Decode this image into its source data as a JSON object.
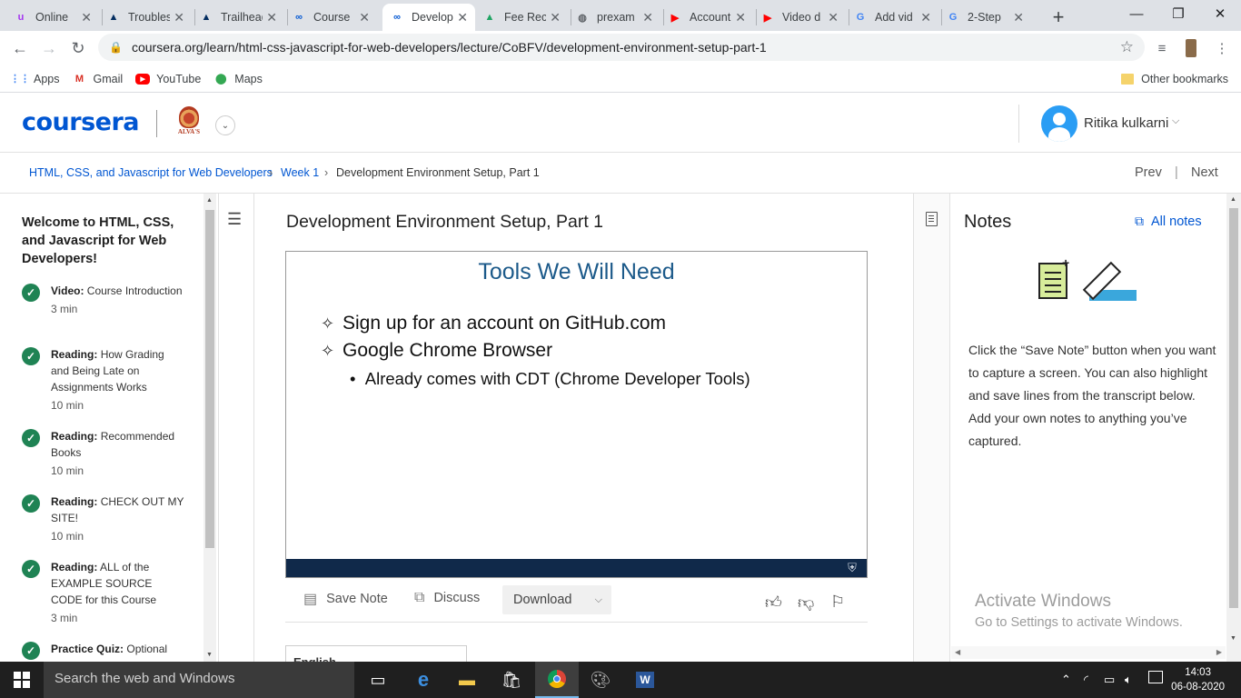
{
  "browser": {
    "tabs": [
      {
        "title": "Online",
        "icon": "udemy-icon",
        "color": "#a435f0",
        "glyph": "u"
      },
      {
        "title": "Troublesh",
        "icon": "trailhead-icon",
        "color": "#032d60",
        "glyph": "▲"
      },
      {
        "title": "Trailhead",
        "icon": "trailhead-icon",
        "color": "#032d60",
        "glyph": "▲"
      },
      {
        "title": "Course",
        "icon": "coursera-icon",
        "color": "#0056d2",
        "glyph": "∞"
      },
      {
        "title": "Develop",
        "icon": "coursera-icon",
        "color": "#0056d2",
        "glyph": "∞",
        "active": true
      },
      {
        "title": "Fee Rec",
        "icon": "drive-icon",
        "color": "#1fa463",
        "glyph": "▲"
      },
      {
        "title": "prexam",
        "icon": "globe-icon",
        "color": "#5f6368",
        "glyph": "◍"
      },
      {
        "title": "Account",
        "icon": "youtube-icon",
        "color": "#ff0000",
        "glyph": "▶"
      },
      {
        "title": "Video d",
        "icon": "youtube-icon",
        "color": "#ff0000",
        "glyph": "▶"
      },
      {
        "title": "Add vid",
        "icon": "google-icon",
        "color": "#4285f4",
        "glyph": "G"
      },
      {
        "title": "2-Step",
        "icon": "google-icon",
        "color": "#4285f4",
        "glyph": "G"
      }
    ],
    "url": "coursera.org/learn/html-css-javascript-for-web-developers/lecture/CoBFV/development-environment-setup-part-1",
    "bookmarks": [
      {
        "label": "Apps",
        "icon": "apps-grid-icon"
      },
      {
        "label": "Gmail",
        "icon": "gmail-icon"
      },
      {
        "label": "YouTube",
        "icon": "youtube-icon"
      },
      {
        "label": "Maps",
        "icon": "maps-pin-icon"
      }
    ],
    "other_bookmarks": "Other bookmarks"
  },
  "header": {
    "logo": "coursera",
    "partner_caption": "ALVA'S",
    "user_name": "Ritika kulkarni"
  },
  "breadcrumb": {
    "course": "HTML, CSS, and Javascript for Web Developers",
    "week": "Week 1",
    "current": "Development Environment Setup, Part 1",
    "separator": "›",
    "prev": "Prev",
    "divider": "|",
    "next": "Next"
  },
  "outline": {
    "heading": "Welcome to HTML, CSS, and Javascript for Web Developers!",
    "items": [
      {
        "type": "Video:",
        "title": "Course Introduction",
        "duration": "3 min"
      },
      {
        "type": "Reading:",
        "title": "How Grading and Being Late on Assignments Works",
        "duration": "10 min"
      },
      {
        "type": "Reading:",
        "title": "Recommended Books",
        "duration": "10 min"
      },
      {
        "type": "Reading:",
        "title": "CHECK OUT MY SITE!",
        "duration": "10 min"
      },
      {
        "type": "Reading:",
        "title": "ALL of the EXAMPLE SOURCE CODE for this Course",
        "duration": "3 min"
      },
      {
        "type": "Practice Quiz:",
        "title": "Optional",
        "duration": ""
      }
    ]
  },
  "lecture": {
    "title": "Development Environment Setup, Part 1",
    "slide": {
      "title": "Tools We Will Need",
      "bullets": [
        "Sign up for an account on GitHub.com",
        "Google Chrome Browser"
      ],
      "sub_bullet": "Already comes with CDT (Chrome Developer Tools)"
    },
    "actions": {
      "save_note": "Save Note",
      "discuss": "Discuss",
      "download": "Download"
    },
    "language": "English"
  },
  "notes": {
    "title": "Notes",
    "all_notes": "All notes",
    "help": "Click the “Save Note” button when you want to capture a screen. You can also highlight and save lines from the transcript below. Add your own notes to anything you’ve captured."
  },
  "watermark": {
    "line1": "Activate Windows",
    "line2": "Go to Settings to activate Windows."
  },
  "taskbar": {
    "search_placeholder": "Search the web and Windows",
    "time": "14:03",
    "date": "06-08-2020"
  },
  "colors": {
    "coursera_blue": "#0056d2",
    "complete_green": "#1f8354",
    "slide_bar": "#10294a"
  }
}
